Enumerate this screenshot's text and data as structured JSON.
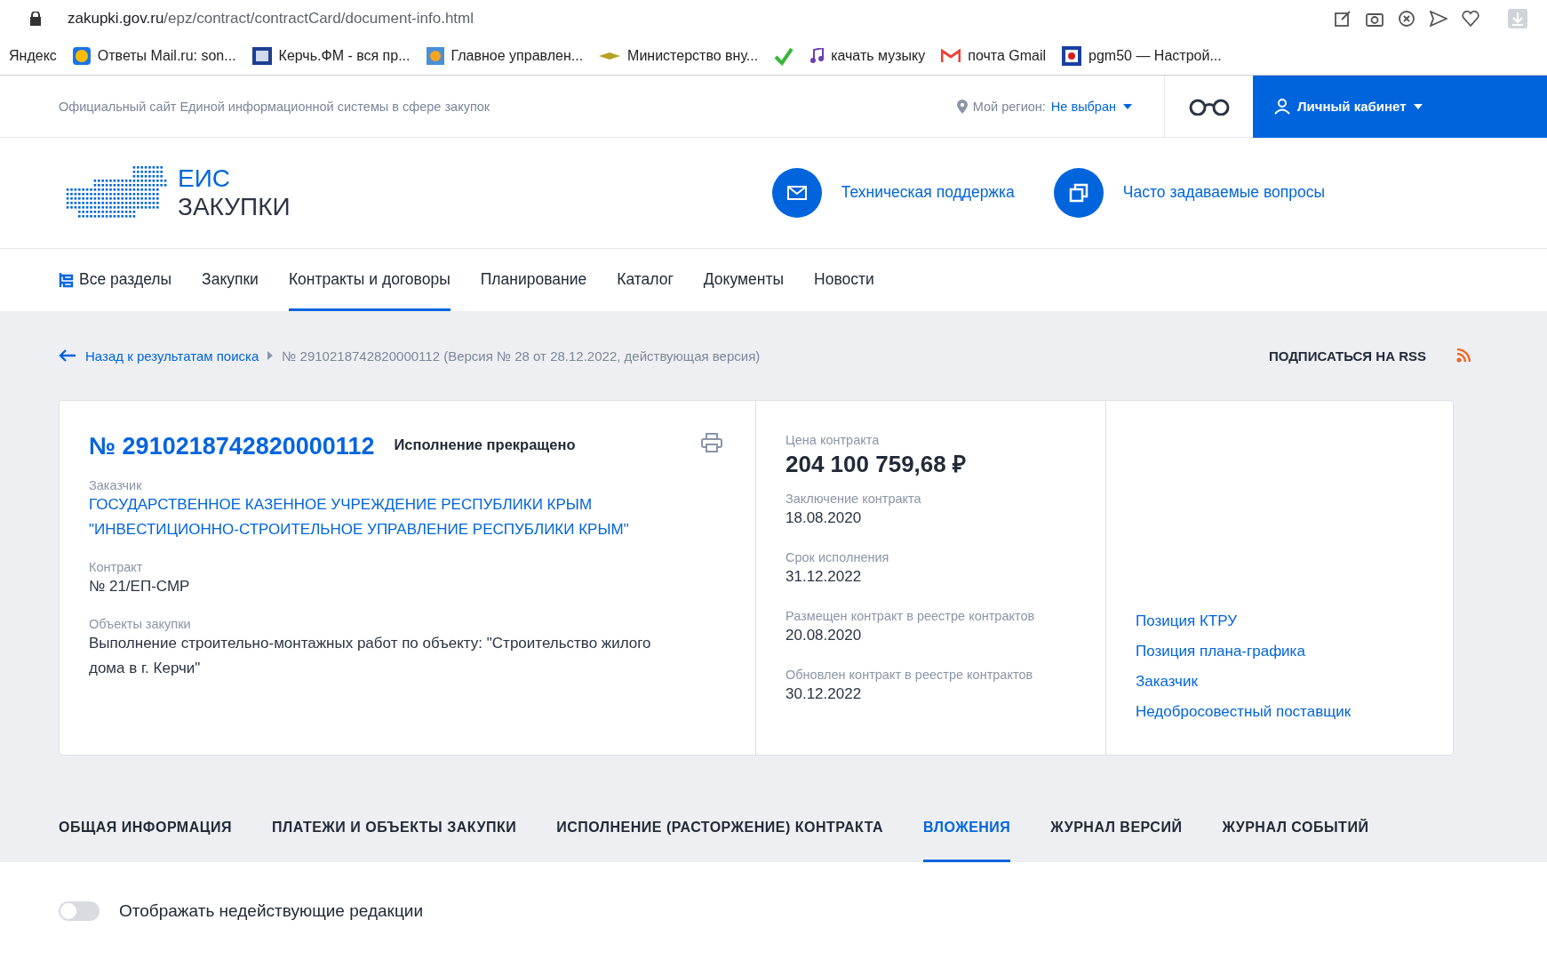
{
  "browser": {
    "url_host": "zakupki.gov.ru",
    "url_path": "/epz/contract/contractCard/document-info.html",
    "bookmarks": [
      {
        "label": "Яндекс",
        "kind": "plain"
      },
      {
        "label": "Ответы Mail.ru: son...",
        "kind": "question"
      },
      {
        "label": "Керчь.ФМ - вся пр...",
        "kind": "square"
      },
      {
        "label": "Главное управлен...",
        "kind": "emblem"
      },
      {
        "label": "Министерство вну...",
        "kind": "wings"
      },
      {
        "kind": "check"
      },
      {
        "label": "качать музыку",
        "kind": "note"
      },
      {
        "label": "почта Gmail",
        "kind": "mail"
      },
      {
        "label": "pgm50 — Настрой...",
        "kind": "flag"
      }
    ]
  },
  "top_bar": {
    "site_title": "Официальный сайт Единой информационной системы в сфере закупок",
    "region_label": "Мой регион:",
    "region_value": "Не выбран",
    "account": "Личный кабинет"
  },
  "header": {
    "logo_top": "ЕИС",
    "logo_bottom": "ЗАКУПКИ",
    "links": [
      {
        "label": "Техническая поддержка",
        "kind": "mail"
      },
      {
        "label": "Часто задаваемые вопросы",
        "kind": "copy"
      }
    ]
  },
  "nav": [
    {
      "label": "Все разделы",
      "selected": false
    },
    {
      "label": "Закупки",
      "selected": false
    },
    {
      "label": "Контракты и договоры",
      "selected": true
    },
    {
      "label": "Планирование",
      "selected": false
    },
    {
      "label": "Каталог",
      "selected": false
    },
    {
      "label": "Документы",
      "selected": false
    },
    {
      "label": "Новости",
      "selected": false
    }
  ],
  "breadcrumb": {
    "back": "Назад к результатам поиска",
    "current": "№ 2910218742820000112 (Версия № 28 от 28.12.2022, действующая версия)",
    "rss": "ПОДПИСАТЬСЯ НА RSS"
  },
  "card": {
    "number": "№ 2910218742820000112",
    "status": "Исполнение прекращено",
    "fields": [
      {
        "label": "Заказчик",
        "value": "ГОСУДАРСТВЕННОЕ КАЗЕННОЕ УЧРЕЖДЕНИЕ РЕСПУБЛИКИ КРЫМ \"ИНВЕСТИЦИОННО-СТРОИТЕЛЬНОЕ УПРАВЛЕНИЕ РЕСПУБЛИКИ КРЫМ\"",
        "kind": "link"
      },
      {
        "label": "Контракт",
        "value": "№ 21/ЕП-СМР",
        "kind": "text"
      },
      {
        "label": "Объекты закупки",
        "value": "Выполнение строительно-монтажных работ по объекту: \"Строительство жилого дома в г. Керчи\"",
        "kind": "text"
      }
    ],
    "price_label": "Цена контракта",
    "price": "204 100 759,68 ₽",
    "dates": [
      {
        "label": "Заключение контракта",
        "value": "18.08.2020"
      },
      {
        "label": "Срок исполнения",
        "value": "31.12.2022"
      },
      {
        "label": "Размещен контракт в реестре контрактов",
        "value": "20.08.2020"
      },
      {
        "label": "Обновлен контракт в реестре контрактов",
        "value": "30.12.2022"
      }
    ],
    "links": [
      "Позиция КТРУ",
      "Позиция плана-графика",
      "Заказчик",
      "Недобросовестный поставщик"
    ]
  },
  "tabs": [
    {
      "label": "ОБЩАЯ ИНФОРМАЦИЯ",
      "selected": false
    },
    {
      "label": "ПЛАТЕЖИ И ОБЪЕКТЫ ЗАКУПКИ",
      "selected": false
    },
    {
      "label": "ИСПОЛНЕНИЕ (РАСТОРЖЕНИЕ) КОНТРАКТА",
      "selected": false
    },
    {
      "label": "ВЛОЖЕНИЯ",
      "selected": true
    },
    {
      "label": "ЖУРНАЛ ВЕРСИЙ",
      "selected": false
    },
    {
      "label": "ЖУРНАЛ СОБЫТИЙ",
      "selected": false
    }
  ],
  "toggle": {
    "label": "Отображать недействующие редакции",
    "on": false
  }
}
